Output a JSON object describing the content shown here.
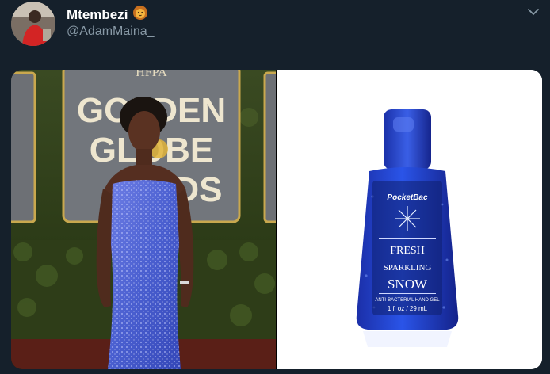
{
  "tweet": {
    "display_name": "Mtembezi",
    "name_emoji": "lion-face-icon",
    "handle": "@AdamMaina_"
  },
  "media": {
    "left_image": {
      "icon": "photo-event-icon",
      "backdrop_text_top": "HFPA",
      "backdrop_text_1": "GOLDEN",
      "backdrop_text_2": "GLOBE",
      "backdrop_text_3": "RDS"
    },
    "right_image": {
      "icon": "sanitizer-bottle-icon",
      "brand": "PocketBac",
      "label_1": "FRESH",
      "label_2": "SPARKLING",
      "label_3": "SNOW",
      "small_line": "ANTI-BACTERIAL HAND GEL",
      "volume": "1 fl oz / 29 mL"
    }
  },
  "colors": {
    "background": "#15202b",
    "secondary_text": "#8899a6",
    "dress_blue": "#4a5fd0",
    "bottle_blue": "#1d3fcf"
  }
}
